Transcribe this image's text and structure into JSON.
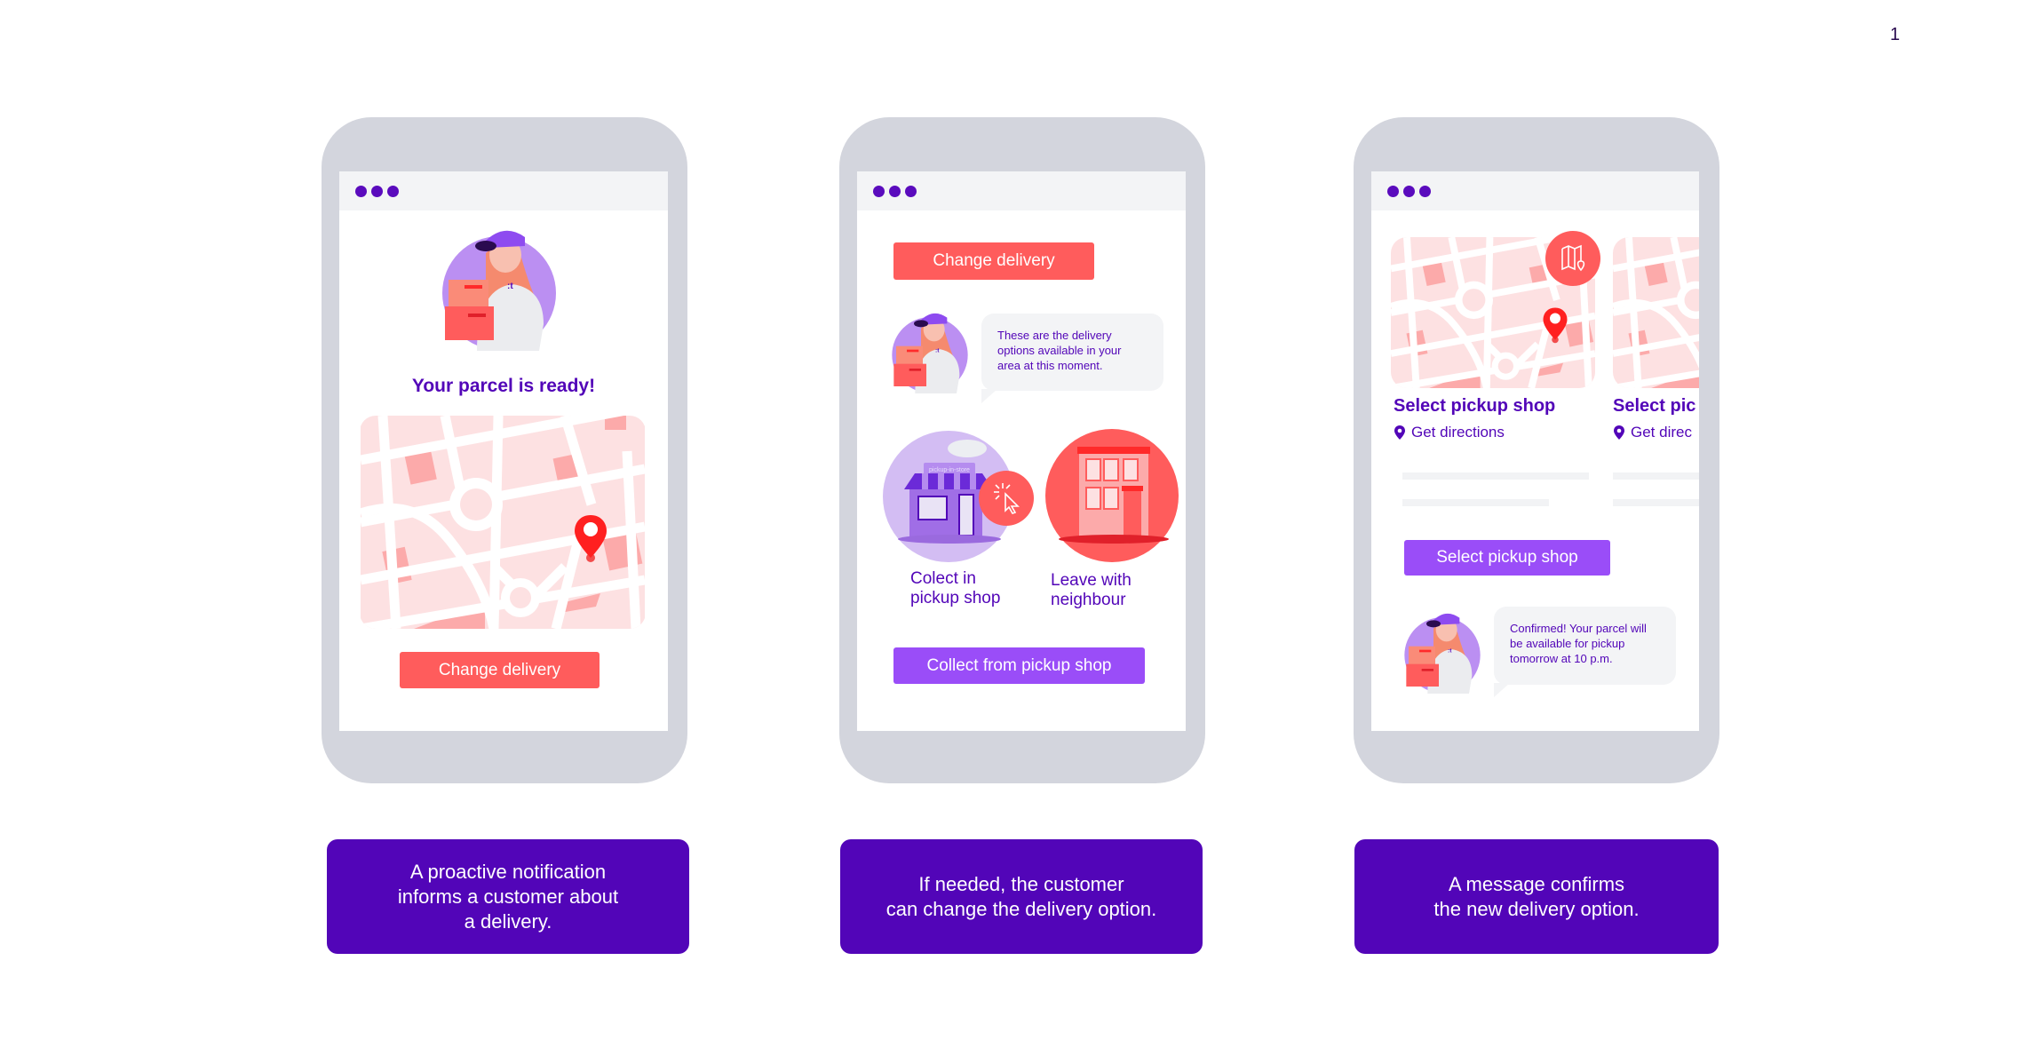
{
  "page_number": "1",
  "colors": {
    "brand_purple": "#5205b8",
    "button_purple": "#9a4df8",
    "coral": "#ff5c5c",
    "phone_frame": "#d3d5dd",
    "map_light": "#fde1e2",
    "map_block": "#fcaaaa",
    "pin_red": "#ff2020"
  },
  "phones": [
    {
      "title": "Your parcel is ready!",
      "button": "Change delivery"
    },
    {
      "top_button": "Change delivery",
      "bubble": "These are the delivery options available in your area at this moment.",
      "shop_sign": "pickup-in-store",
      "options": [
        {
          "label_line1": "Colect in",
          "label_line2": "pickup shop"
        },
        {
          "label_line1": "Leave with",
          "label_line2": "neighbour"
        }
      ],
      "button": "Collect from pickup shop"
    },
    {
      "cards": [
        {
          "title": "Select pickup shop",
          "link": "Get directions"
        },
        {
          "title": "Select pic",
          "link": "Get direc"
        }
      ],
      "button": "Select pickup shop",
      "bubble": "Confirmed! Your parcel will be available for pickup tomorrow at 10 p.m."
    }
  ],
  "captions": [
    {
      "line1": "A proactive notification",
      "line2": "informs a customer about",
      "line3": "a delivery."
    },
    {
      "line1": "If needed, the customer",
      "line2": "can change the delivery option."
    },
    {
      "line1": "A message confirms",
      "line2": "the new delivery option."
    }
  ]
}
